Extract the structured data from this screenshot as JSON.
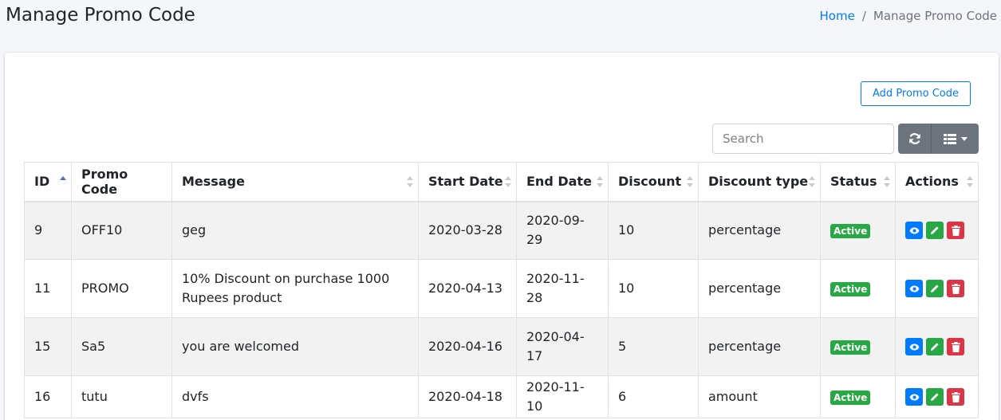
{
  "header": {
    "title": "Manage Promo Code",
    "breadcrumb": {
      "home": "Home",
      "separator": "/",
      "current": "Manage Promo Code"
    }
  },
  "toolbar": {
    "add_label": "Add Promo Code",
    "search_placeholder": "Search"
  },
  "table": {
    "columns": [
      "ID",
      "Promo Code",
      "Message",
      "Start Date",
      "End Date",
      "Discount",
      "Discount type",
      "Status",
      "Actions"
    ],
    "rows": [
      {
        "id": "9",
        "code": "OFF10",
        "message": "geg",
        "start": "2020-03-28",
        "end": "2020-09-29",
        "discount": "10",
        "type": "percentage",
        "status": "Active"
      },
      {
        "id": "11",
        "code": "PROMO",
        "message": "10% Discount on purchase 1000 Rupees product",
        "start": "2020-04-13",
        "end": "2020-11-28",
        "discount": "10",
        "type": "percentage",
        "status": "Active"
      },
      {
        "id": "15",
        "code": "Sa5",
        "message": "you are welcomed",
        "start": "2020-04-16",
        "end": "2020-04-17",
        "discount": "5",
        "type": "percentage",
        "status": "Active"
      },
      {
        "id": "16",
        "code": "tutu",
        "message": "dvfs",
        "start": "2020-04-18",
        "end": "2020-11-10",
        "discount": "6",
        "type": "amount",
        "status": "Active"
      }
    ]
  },
  "colors": {
    "primary": "#007bff",
    "success": "#28a745",
    "danger": "#dc3545",
    "secondary": "#6c757d"
  },
  "icons": {
    "view": "eye-icon",
    "edit": "pencil-icon",
    "delete": "trash-icon",
    "refresh": "refresh-icon",
    "columns": "columns-icon"
  }
}
